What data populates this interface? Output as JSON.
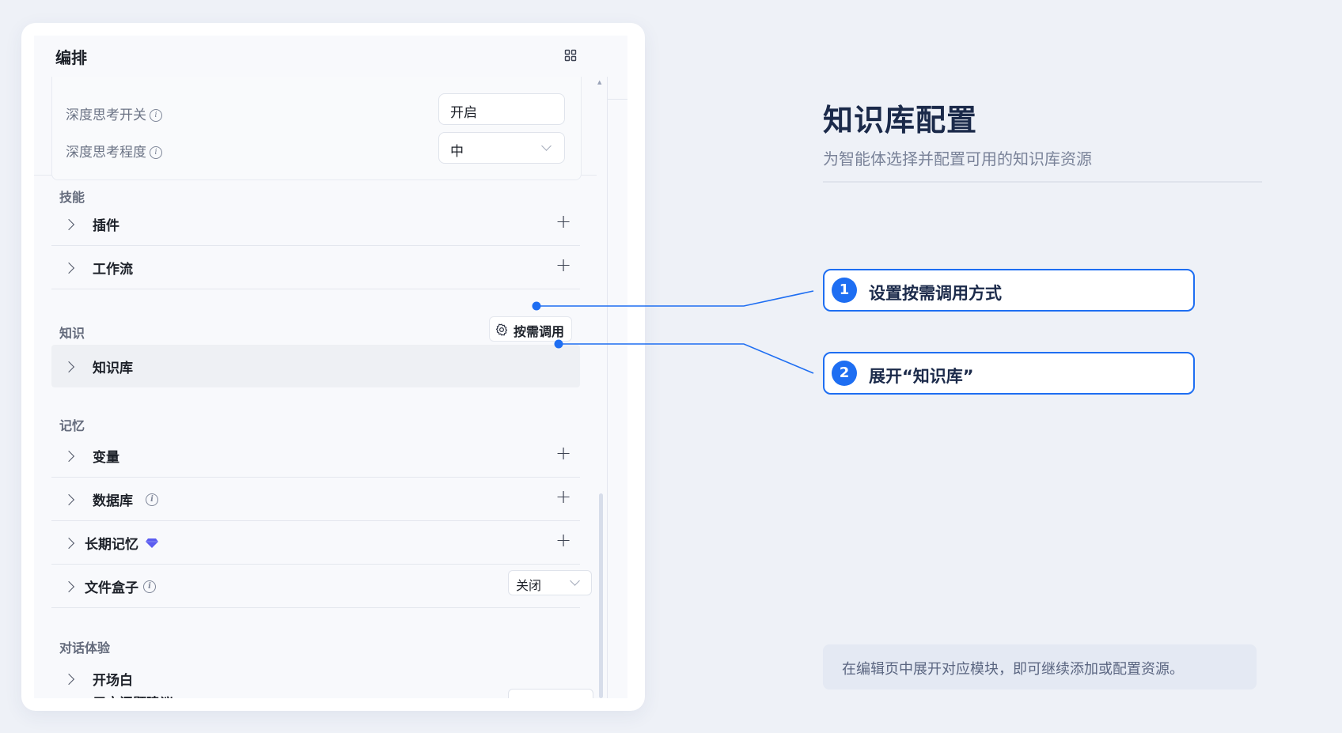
{
  "editor": {
    "title": "编排",
    "prev_section": {
      "row1_label": "深度思考开关",
      "row1_value": "开启",
      "row2_label": "深度思考程度",
      "row2_value": "中"
    },
    "skills": {
      "title": "技能",
      "items": [
        "插件",
        "工作流"
      ]
    },
    "knowledge": {
      "title": "知识",
      "action_label": "按需调用",
      "items": [
        "知识库"
      ]
    },
    "memory": {
      "title": "记忆",
      "items": [
        "变量",
        "数据库",
        "长期记忆",
        "文件盒子"
      ],
      "file_box_value": "关闭"
    },
    "dialog": {
      "title": "对话体验",
      "items": [
        "开场白"
      ],
      "cut_item": "用户问题建议"
    }
  },
  "guide": {
    "title": "知识库配置",
    "subtitle": "为智能体选择并配置可用的知识库资源",
    "steps": [
      {
        "number": "1",
        "text": "设置按需调用方式"
      },
      {
        "number": "2",
        "text": "展开“知识库”"
      }
    ],
    "note": "在编辑页中展开对应模块，即可继续添加或配置资源。"
  },
  "colors": {
    "accent": "#1e6ef2",
    "title": "#1b2a4a",
    "premium_gem": "#5b5cf0"
  },
  "icons": [
    "grid-icon",
    "info-icon",
    "chevron-right-icon",
    "plus-icon",
    "gear-icon",
    "chevron-down-icon",
    "diamond-icon"
  ]
}
